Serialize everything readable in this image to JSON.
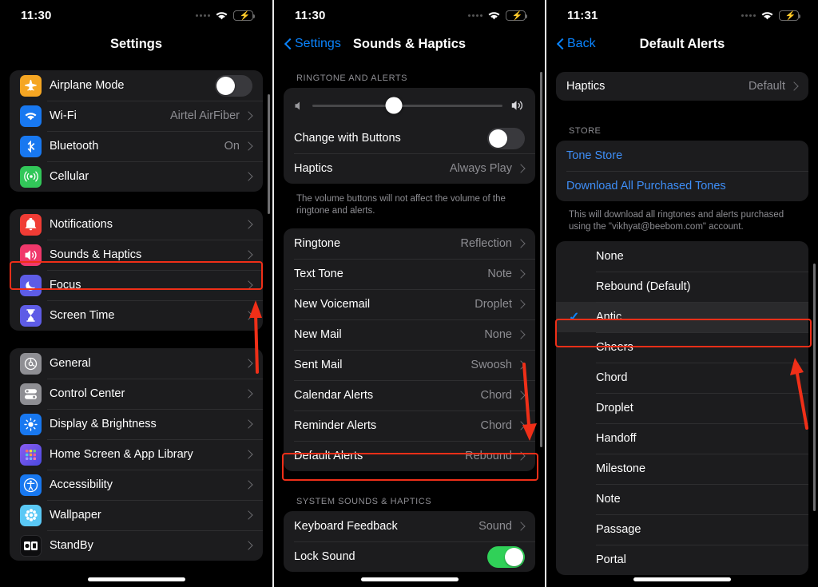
{
  "panels": [
    {
      "id": "settings",
      "status": {
        "time": "11:30",
        "wifi_icon": "wifi-icon",
        "battery_icon": "battery-charging-icon",
        "signal_icon": "cellular-dots-icon"
      },
      "nav": {
        "title": "Settings",
        "back_label": null
      },
      "groups": [
        {
          "rows": [
            {
              "label": "Airplane Mode",
              "icon": "airplane-icon",
              "icon_color": "#f5a623",
              "control": "toggle",
              "toggle_on": false
            },
            {
              "label": "Wi-Fi",
              "icon": "wifi-icon",
              "icon_color": "#1878f0",
              "value": "Airtel AirFiber",
              "control": "chevron"
            },
            {
              "label": "Bluetooth",
              "icon": "bluetooth-icon",
              "icon_color": "#1878f0",
              "value": "On",
              "control": "chevron"
            },
            {
              "label": "Cellular",
              "icon": "cellular-icon",
              "icon_color": "#32c759",
              "value": "",
              "control": "chevron"
            }
          ]
        },
        {
          "rows": [
            {
              "label": "Notifications",
              "icon": "bell-icon",
              "icon_color": "#f03c35",
              "value": "",
              "control": "chevron"
            },
            {
              "label": "Sounds & Haptics",
              "icon": "speaker-waves-icon",
              "icon_color": "#f0386b",
              "value": "",
              "control": "chevron",
              "highlight": true
            },
            {
              "label": "Focus",
              "icon": "moon-icon",
              "icon_color": "#5e5ce6",
              "value": "",
              "control": "chevron"
            },
            {
              "label": "Screen Time",
              "icon": "hourglass-icon",
              "icon_color": "#5e5ce6",
              "value": "",
              "control": "chevron"
            }
          ]
        },
        {
          "rows": [
            {
              "label": "General",
              "icon": "gear-icon",
              "icon_color": "#8e8e93",
              "value": "",
              "control": "chevron"
            },
            {
              "label": "Control Center",
              "icon": "sliders-icon",
              "icon_color": "#8e8e93",
              "value": "",
              "control": "chevron"
            },
            {
              "label": "Display & Brightness",
              "icon": "brightness-icon",
              "icon_color": "#1878f0",
              "value": "",
              "control": "chevron"
            },
            {
              "label": "Home Screen & App Library",
              "icon": "app-grid-icon",
              "icon_color": "#6b5ce7",
              "value": "",
              "control": "chevron"
            },
            {
              "label": "Accessibility",
              "icon": "accessibility-icon",
              "icon_color": "#1878f0",
              "value": "",
              "control": "chevron"
            },
            {
              "label": "Wallpaper",
              "icon": "flower-icon",
              "icon_color": "#5ac8f5",
              "value": "",
              "control": "chevron"
            },
            {
              "label": "StandBy",
              "icon": "standby-icon",
              "icon_color": "#1c1c1e",
              "value": "",
              "control": "chevron"
            }
          ]
        }
      ]
    },
    {
      "id": "sounds-haptics",
      "status": {
        "time": "11:30"
      },
      "nav": {
        "title": "Sounds & Haptics",
        "back_label": "Settings"
      },
      "section1_header": "RINGTONE AND ALERTS",
      "slider": {
        "value_percent": 43,
        "left_icon": "speaker-low-icon",
        "right_icon": "speaker-high-icon"
      },
      "rows1": [
        {
          "label": "Change with Buttons",
          "control": "toggle",
          "toggle_on": false
        },
        {
          "label": "Haptics",
          "value": "Always Play",
          "control": "chevron"
        }
      ],
      "footer1": "The volume buttons will not affect the volume of the ringtone and alerts.",
      "rows2": [
        {
          "label": "Ringtone",
          "value": "Reflection",
          "control": "chevron"
        },
        {
          "label": "Text Tone",
          "value": "Note",
          "control": "chevron"
        },
        {
          "label": "New Voicemail",
          "value": "Droplet",
          "control": "chevron"
        },
        {
          "label": "New Mail",
          "value": "None",
          "control": "chevron"
        },
        {
          "label": "Sent Mail",
          "value": "Swoosh",
          "control": "chevron"
        },
        {
          "label": "Calendar Alerts",
          "value": "Chord",
          "control": "chevron"
        },
        {
          "label": "Reminder Alerts",
          "value": "Chord",
          "control": "chevron"
        },
        {
          "label": "Default Alerts",
          "value": "Rebound",
          "control": "chevron",
          "highlight": true
        }
      ],
      "section2_header": "SYSTEM SOUNDS & HAPTICS",
      "rows3": [
        {
          "label": "Keyboard Feedback",
          "value": "Sound",
          "control": "chevron"
        },
        {
          "label": "Lock Sound",
          "control": "toggle",
          "toggle_on": true
        }
      ]
    },
    {
      "id": "default-alerts",
      "status": {
        "time": "11:31"
      },
      "nav": {
        "title": "Default Alerts",
        "back_label": "Back"
      },
      "haptics_row": {
        "label": "Haptics",
        "value": "Default",
        "control": "chevron"
      },
      "store_header": "STORE",
      "store_links": [
        {
          "label": "Tone Store"
        },
        {
          "label": "Download All Purchased Tones"
        }
      ],
      "store_footer": "This will download all ringtones and alerts purchased using the \"vikhyat@beebom.com\" account.",
      "tones": [
        {
          "label": "None",
          "selected": false
        },
        {
          "label": "Rebound (Default)",
          "selected": false
        },
        {
          "label": "Antic",
          "selected": true,
          "highlight": true
        },
        {
          "label": "Cheers",
          "selected": false
        },
        {
          "label": "Chord",
          "selected": false
        },
        {
          "label": "Droplet",
          "selected": false
        },
        {
          "label": "Handoff",
          "selected": false
        },
        {
          "label": "Milestone",
          "selected": false
        },
        {
          "label": "Note",
          "selected": false
        },
        {
          "label": "Passage",
          "selected": false
        },
        {
          "label": "Portal",
          "selected": false
        }
      ]
    }
  ],
  "annotation": {
    "box_color": "#ef2f18",
    "arrow_color": "#ef2f18",
    "arrows": [
      {
        "id": "arrow-to-sounds-haptics",
        "direction": "up"
      },
      {
        "id": "arrow-to-default-alerts",
        "direction": "down"
      },
      {
        "id": "arrow-to-antic",
        "direction": "up"
      }
    ]
  }
}
